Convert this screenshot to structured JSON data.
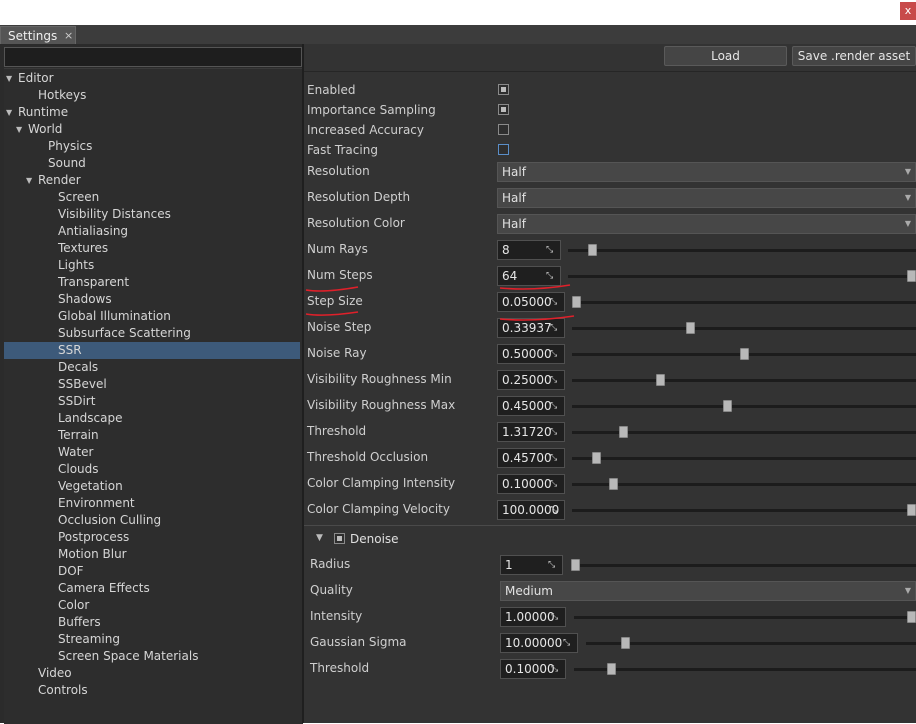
{
  "window": {
    "close_glyph": "x"
  },
  "tab": {
    "label": "Settings",
    "close_glyph": "×"
  },
  "search": {
    "value": "",
    "placeholder": ""
  },
  "tree": [
    {
      "label": "Editor",
      "indent": 0,
      "expanded": true
    },
    {
      "label": "Hotkeys",
      "indent": 2
    },
    {
      "label": "Runtime",
      "indent": 0,
      "expanded": true
    },
    {
      "label": "World",
      "indent": 1,
      "expanded": true
    },
    {
      "label": "Physics",
      "indent": 3
    },
    {
      "label": "Sound",
      "indent": 3
    },
    {
      "label": "Render",
      "indent": 2,
      "expanded": true
    },
    {
      "label": "Screen",
      "indent": 4
    },
    {
      "label": "Visibility Distances",
      "indent": 4
    },
    {
      "label": "Antialiasing",
      "indent": 4
    },
    {
      "label": "Textures",
      "indent": 4
    },
    {
      "label": "Lights",
      "indent": 4
    },
    {
      "label": "Transparent",
      "indent": 4
    },
    {
      "label": "Shadows",
      "indent": 4
    },
    {
      "label": "Global Illumination",
      "indent": 4
    },
    {
      "label": "Subsurface Scattering",
      "indent": 4
    },
    {
      "label": "SSR",
      "indent": 4,
      "selected": true
    },
    {
      "label": "Decals",
      "indent": 4
    },
    {
      "label": "SSBevel",
      "indent": 4
    },
    {
      "label": "SSDirt",
      "indent": 4
    },
    {
      "label": "Landscape",
      "indent": 4
    },
    {
      "label": "Terrain",
      "indent": 4
    },
    {
      "label": "Water",
      "indent": 4
    },
    {
      "label": "Clouds",
      "indent": 4
    },
    {
      "label": "Vegetation",
      "indent": 4
    },
    {
      "label": "Environment",
      "indent": 4
    },
    {
      "label": "Occlusion Culling",
      "indent": 4
    },
    {
      "label": "Postprocess",
      "indent": 4
    },
    {
      "label": "Motion Blur",
      "indent": 4
    },
    {
      "label": "DOF",
      "indent": 4
    },
    {
      "label": "Camera Effects",
      "indent": 4
    },
    {
      "label": "Color",
      "indent": 4
    },
    {
      "label": "Buffers",
      "indent": 4
    },
    {
      "label": "Streaming",
      "indent": 4
    },
    {
      "label": "Screen Space Materials",
      "indent": 4
    },
    {
      "label": "Video",
      "indent": 2
    },
    {
      "label": "Controls",
      "indent": 2
    }
  ],
  "toolbar": {
    "load_label": "Load",
    "save_label": "Save .render asset"
  },
  "checkboxes": [
    {
      "label": "Enabled",
      "checked": true
    },
    {
      "label": "Importance Sampling",
      "checked": true
    },
    {
      "label": "Increased Accuracy",
      "checked": false
    },
    {
      "label": "Fast Tracing",
      "checked": false,
      "focused": true
    }
  ],
  "dropdowns": [
    {
      "label": "Resolution",
      "value": "Half"
    },
    {
      "label": "Resolution Depth",
      "value": "Half"
    },
    {
      "label": "Resolution Color",
      "value": "Half"
    }
  ],
  "sliders": [
    {
      "label": "Num Rays",
      "value": "8",
      "level": 0.06
    },
    {
      "label": "Num Steps",
      "value": "64",
      "level": 1.0
    },
    {
      "label": "Step Size",
      "value": "0.05000",
      "level": 0.0
    },
    {
      "label": "Noise Step",
      "value": "0.33937",
      "level": 0.34
    },
    {
      "label": "Noise Ray",
      "value": "0.50000",
      "level": 0.5
    },
    {
      "label": "Visibility Roughness Min",
      "value": "0.25000",
      "level": 0.25
    },
    {
      "label": "Visibility Roughness Max",
      "value": "0.45000",
      "level": 0.45
    },
    {
      "label": "Threshold",
      "value": "1.31720",
      "level": 0.14
    },
    {
      "label": "Threshold Occlusion",
      "value": "0.45700",
      "level": 0.06
    },
    {
      "label": "Color Clamping Intensity",
      "value": "0.10000",
      "level": 0.11
    },
    {
      "label": "Color Clamping Velocity",
      "value": "100.0000",
      "level": 1.0
    }
  ],
  "denoise": {
    "title": "Denoise",
    "enabled": true,
    "expanded": true,
    "radius": {
      "label": "Radius",
      "value": "1",
      "level": 0.0
    },
    "quality": {
      "label": "Quality",
      "value": "Medium"
    },
    "intensity": {
      "label": "Intensity",
      "value": "1.00000",
      "level": 1.0
    },
    "gaussian_sigma": {
      "label": "Gaussian Sigma",
      "value": "10.00000",
      "level": 0.11
    },
    "threshold": {
      "label": "Threshold",
      "value": "0.10000",
      "level": 0.1
    }
  },
  "colors": {
    "selection": "#3d5a7a",
    "annotation": "#e0202a",
    "focus_blue": "#5a8ec8"
  },
  "icons": {
    "resize": "resize-icon",
    "expand": "triangle-down-icon",
    "dropdown": "chevron-down-icon"
  }
}
